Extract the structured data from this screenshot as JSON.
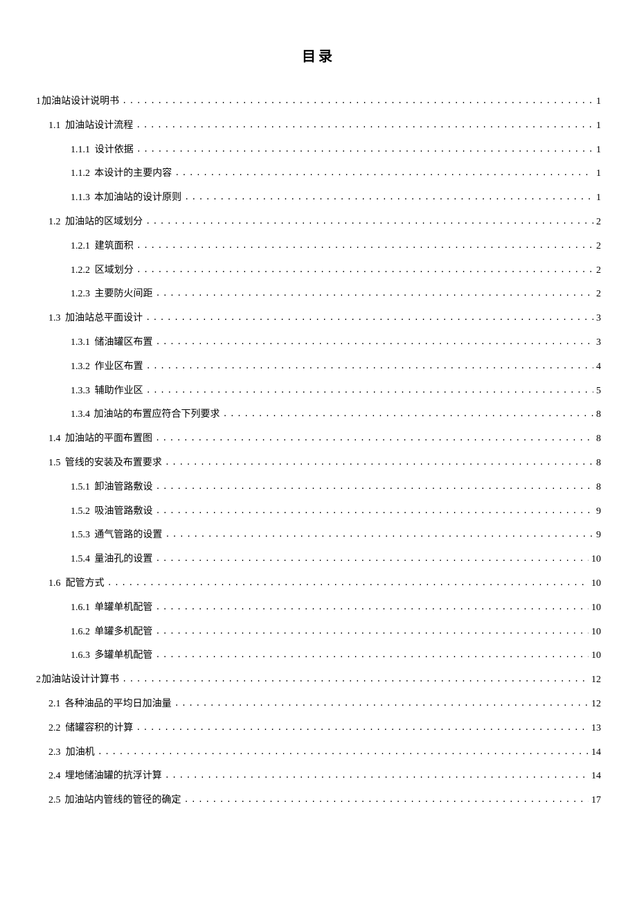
{
  "title": "目录",
  "entries": [
    {
      "level": 0,
      "num": "1",
      "label": "加油站设计说明书",
      "page": "1",
      "numStyle": "tight"
    },
    {
      "level": 1,
      "num": "1.1",
      "label": "加油站设计流程",
      "page": "1"
    },
    {
      "level": 2,
      "num": "1.1.1",
      "label": "设计依据",
      "page": "1"
    },
    {
      "level": 2,
      "num": "1.1.2",
      "label": "本设计的主要内容",
      "page": "1"
    },
    {
      "level": 2,
      "num": "1.1.3",
      "label": "本加油站的设计原则",
      "page": "1"
    },
    {
      "level": 1,
      "num": "1.2",
      "label": "加油站的区域划分",
      "page": "2"
    },
    {
      "level": 2,
      "num": "1.2.1",
      "label": "建筑面积",
      "page": "2"
    },
    {
      "level": 2,
      "num": "1.2.2",
      "label": "区域划分",
      "page": "2"
    },
    {
      "level": 2,
      "num": "1.2.3",
      "label": "主要防火间距",
      "page": "2"
    },
    {
      "level": 1,
      "num": "1.3",
      "label": "加油站总平面设计",
      "page": "3"
    },
    {
      "level": 2,
      "num": "1.3.1",
      "label": "储油罐区布置",
      "page": "3"
    },
    {
      "level": 2,
      "num": "1.3.2",
      "label": "作业区布置",
      "page": "4"
    },
    {
      "level": 2,
      "num": "1.3.3",
      "label": "辅助作业区",
      "page": "5"
    },
    {
      "level": 2,
      "num": "1.3.4",
      "label": "加油站的布置应符合下列要求",
      "page": "8"
    },
    {
      "level": 1,
      "num": "1.4",
      "label": "加油站的平面布置图",
      "page": "8"
    },
    {
      "level": 1,
      "num": "1.5",
      "label": "管线的安装及布置要求",
      "page": "8"
    },
    {
      "level": 2,
      "num": "1.5.1",
      "label": "卸油管路敷设",
      "page": "8"
    },
    {
      "level": 2,
      "num": "1.5.2",
      "label": "吸油管路敷设",
      "page": "9"
    },
    {
      "level": 2,
      "num": "1.5.3",
      "label": "通气管路的设置",
      "page": "9"
    },
    {
      "level": 2,
      "num": "1.5.4",
      "label": "量油孔的设置",
      "page": "10"
    },
    {
      "level": 1,
      "num": "1.6",
      "label": "配管方式",
      "page": "10"
    },
    {
      "level": 2,
      "num": "1.6.1",
      "label": "单罐单机配管",
      "page": "10"
    },
    {
      "level": 2,
      "num": "1.6.2",
      "label": "单罐多机配管",
      "page": "10"
    },
    {
      "level": 2,
      "num": "1.6.3",
      "label": "多罐单机配管",
      "page": "10"
    },
    {
      "level": 0,
      "num": "2",
      "label": "加油站设计计算书",
      "page": "12",
      "numStyle": "tight"
    },
    {
      "level": 1,
      "num": "2.1",
      "label": "各种油品的平均日加油量",
      "page": "12"
    },
    {
      "level": 1,
      "num": "2.2",
      "label": "储罐容积的计算",
      "page": "13"
    },
    {
      "level": 1,
      "num": "2.3",
      "label": "加油机",
      "page": "14"
    },
    {
      "level": 1,
      "num": "2.4",
      "label": "埋地储油罐的抗浮计算",
      "page": "14"
    },
    {
      "level": 1,
      "num": "2.5",
      "label": "加油站内管线的管径的确定",
      "page": "17"
    }
  ]
}
